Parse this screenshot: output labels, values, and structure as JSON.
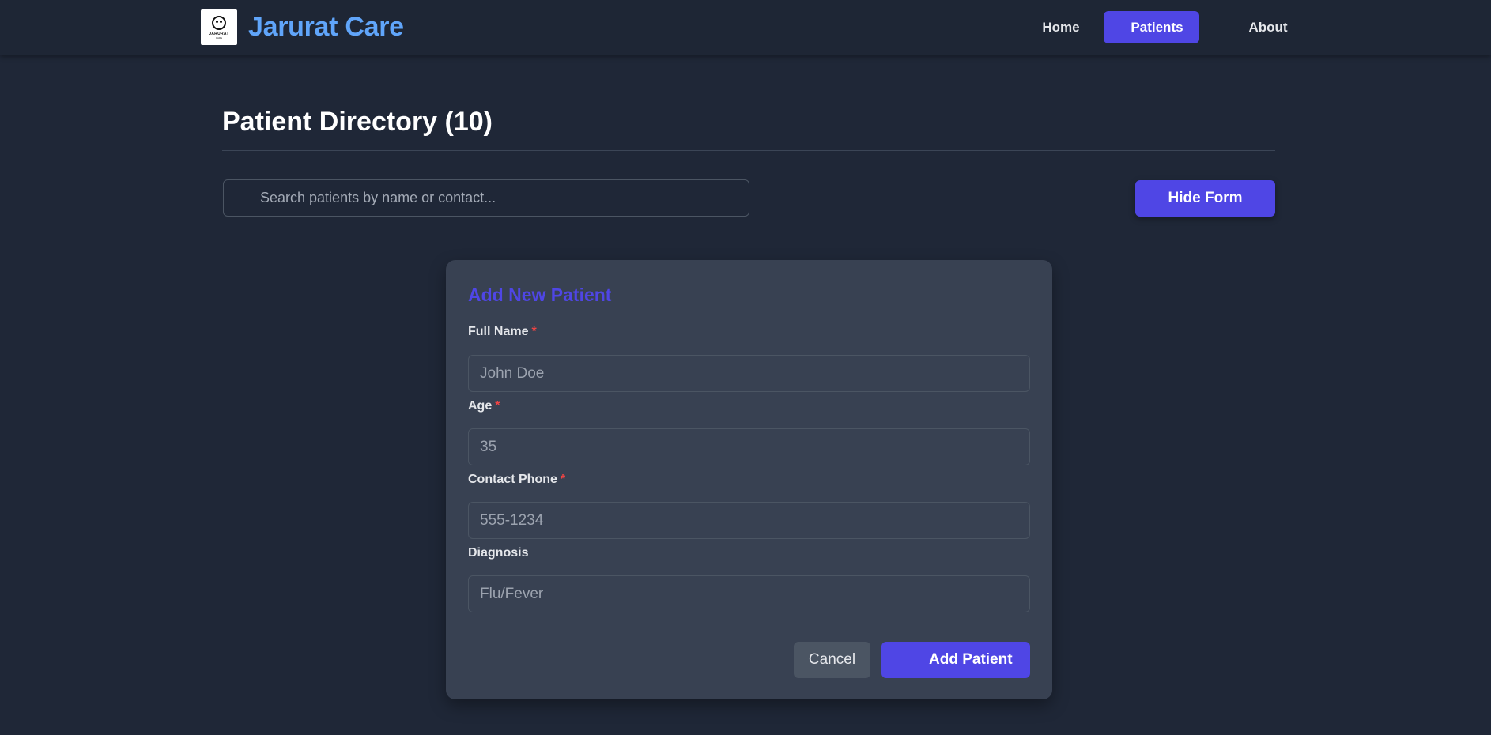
{
  "brand": {
    "logo_text": "JARURAT",
    "logo_sub": "CARE",
    "name": "Jarurat Care"
  },
  "nav": {
    "items": [
      {
        "label": "Home",
        "active": false
      },
      {
        "label": "Patients",
        "active": true
      },
      {
        "label": "About",
        "active": false
      }
    ]
  },
  "page": {
    "title": "Patient Directory (10)"
  },
  "search": {
    "placeholder": "Search patients by name or contact...",
    "value": ""
  },
  "toolbar": {
    "hide_form_label": "Hide Form"
  },
  "form": {
    "title": "Add New Patient",
    "required_marker": "*",
    "fields": [
      {
        "label": "Full Name",
        "required": true,
        "placeholder": "John Doe",
        "value": ""
      },
      {
        "label": "Age",
        "required": true,
        "placeholder": "35",
        "value": ""
      },
      {
        "label": "Contact Phone",
        "required": true,
        "placeholder": "555-1234",
        "value": ""
      },
      {
        "label": "Diagnosis",
        "required": false,
        "placeholder": "Flu/Fever",
        "value": ""
      }
    ],
    "cancel_label": "Cancel",
    "submit_label": "Add Patient"
  },
  "colors": {
    "accent": "#4f46e5",
    "brand": "#60a5fa",
    "required": "#ef4444",
    "background": "#1f2737",
    "card": "#384152"
  }
}
